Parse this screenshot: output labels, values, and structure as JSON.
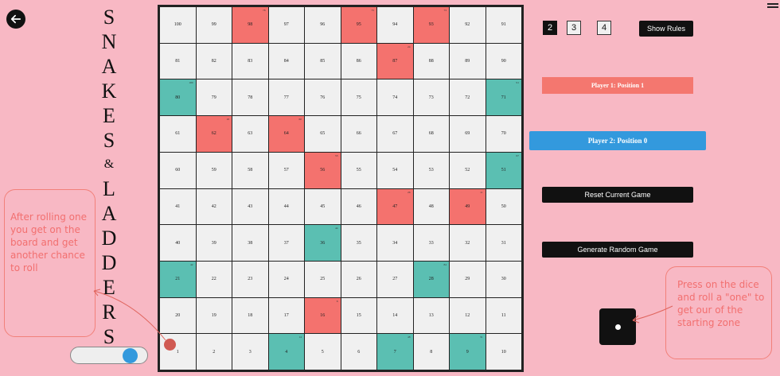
{
  "title_letters": [
    "S",
    "N",
    "A",
    "K",
    "E",
    "S",
    "&",
    "L",
    "A",
    "D",
    "D",
    "E",
    "R",
    "S"
  ],
  "board": {
    "rows": [
      [
        100,
        99,
        98,
        97,
        96,
        95,
        94,
        93,
        92,
        91
      ],
      [
        81,
        82,
        83,
        84,
        85,
        86,
        87,
        88,
        89,
        90
      ],
      [
        80,
        79,
        78,
        77,
        76,
        75,
        74,
        73,
        72,
        71
      ],
      [
        61,
        62,
        63,
        64,
        65,
        66,
        67,
        68,
        69,
        70
      ],
      [
        60,
        59,
        58,
        57,
        56,
        55,
        54,
        53,
        52,
        51
      ],
      [
        41,
        42,
        43,
        44,
        45,
        46,
        47,
        48,
        49,
        50
      ],
      [
        40,
        39,
        38,
        37,
        36,
        35,
        34,
        33,
        32,
        31
      ],
      [
        21,
        22,
        23,
        24,
        25,
        26,
        27,
        28,
        29,
        30
      ],
      [
        20,
        19,
        18,
        17,
        16,
        15,
        14,
        13,
        12,
        11
      ],
      [
        1,
        2,
        3,
        4,
        5,
        6,
        7,
        8,
        9,
        10
      ]
    ],
    "snakes": {
      "98": "78",
      "95": "75",
      "93": "73",
      "87": "24",
      "62": "18",
      "64": "60",
      "56": "53",
      "47": "26",
      "49": "11",
      "16": "6"
    },
    "ladders": {
      "80": "100",
      "71": "91",
      "51": "67",
      "36": "44",
      "28": "84",
      "21": "42",
      "4": "14",
      "7": "48",
      "9": "31"
    }
  },
  "players": {
    "options": [
      "2",
      "3",
      "4"
    ],
    "selected": "2",
    "p1_label": "Player 1: Position 1",
    "p2_label": "Player 2: Position 0"
  },
  "buttons": {
    "rules": "Show Rules",
    "reset": "Reset Current Game",
    "random": "Generate Random Game"
  },
  "notes": {
    "left": "After rolling one you get on the board and get another chance to roll",
    "right": "Press on the dice and roll a \"one\" to get our of the starting zone"
  },
  "colors": {
    "background": "#f8b8c4",
    "snake": "#f4726e",
    "ladder": "#5bbfb2",
    "player1": "#f4776f",
    "player2": "#3399dd"
  },
  "icons": {
    "back": "arrow-left-icon",
    "menu": "hamburger-menu-icon"
  }
}
